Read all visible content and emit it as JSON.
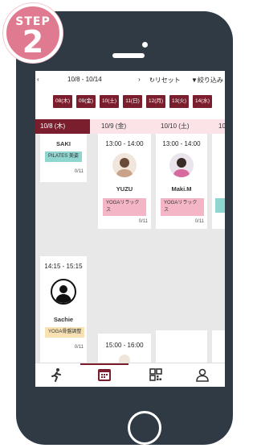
{
  "step": {
    "word": "STEP",
    "number": "2"
  },
  "toolbar": {
    "prev": "‹",
    "range": "10/8 - 10/14",
    "next": "›",
    "reset_label": "リセット",
    "filter_label": "絞り込み"
  },
  "date_chips": [
    "08(木)",
    "09(金)",
    "10(土)",
    "11(日)",
    "12(月)",
    "13(火)",
    "14(水)"
  ],
  "columns": [
    {
      "label": "10/8 (木)",
      "active": true
    },
    {
      "label": "10/9 (金)",
      "active": false
    },
    {
      "label": "10/10 (土)",
      "active": false
    },
    {
      "label": "10",
      "active": false
    }
  ],
  "sessions": {
    "saki": {
      "name": "SAKI",
      "tag": "PILATES 美姿",
      "capacity": "0/11"
    },
    "yuzu": {
      "time": "13:00 - 14:00",
      "name": "YUZU",
      "tag": "YOGAリラックス",
      "capacity": "0/11"
    },
    "maki": {
      "time": "13:00 - 14:00",
      "name": "Maki.M",
      "tag": "YOGAリラックス",
      "capacity": "0/11"
    },
    "sachie": {
      "time": "14:15 - 15:15",
      "name": "Sachie",
      "tag": "YOGA骨盤調整",
      "capacity": "0/11"
    },
    "next": {
      "time": "15:00 - 16:00"
    }
  },
  "colors": {
    "accent": "#7a1e2e",
    "badge": "#e07a90",
    "phone": "#2f3a44"
  }
}
